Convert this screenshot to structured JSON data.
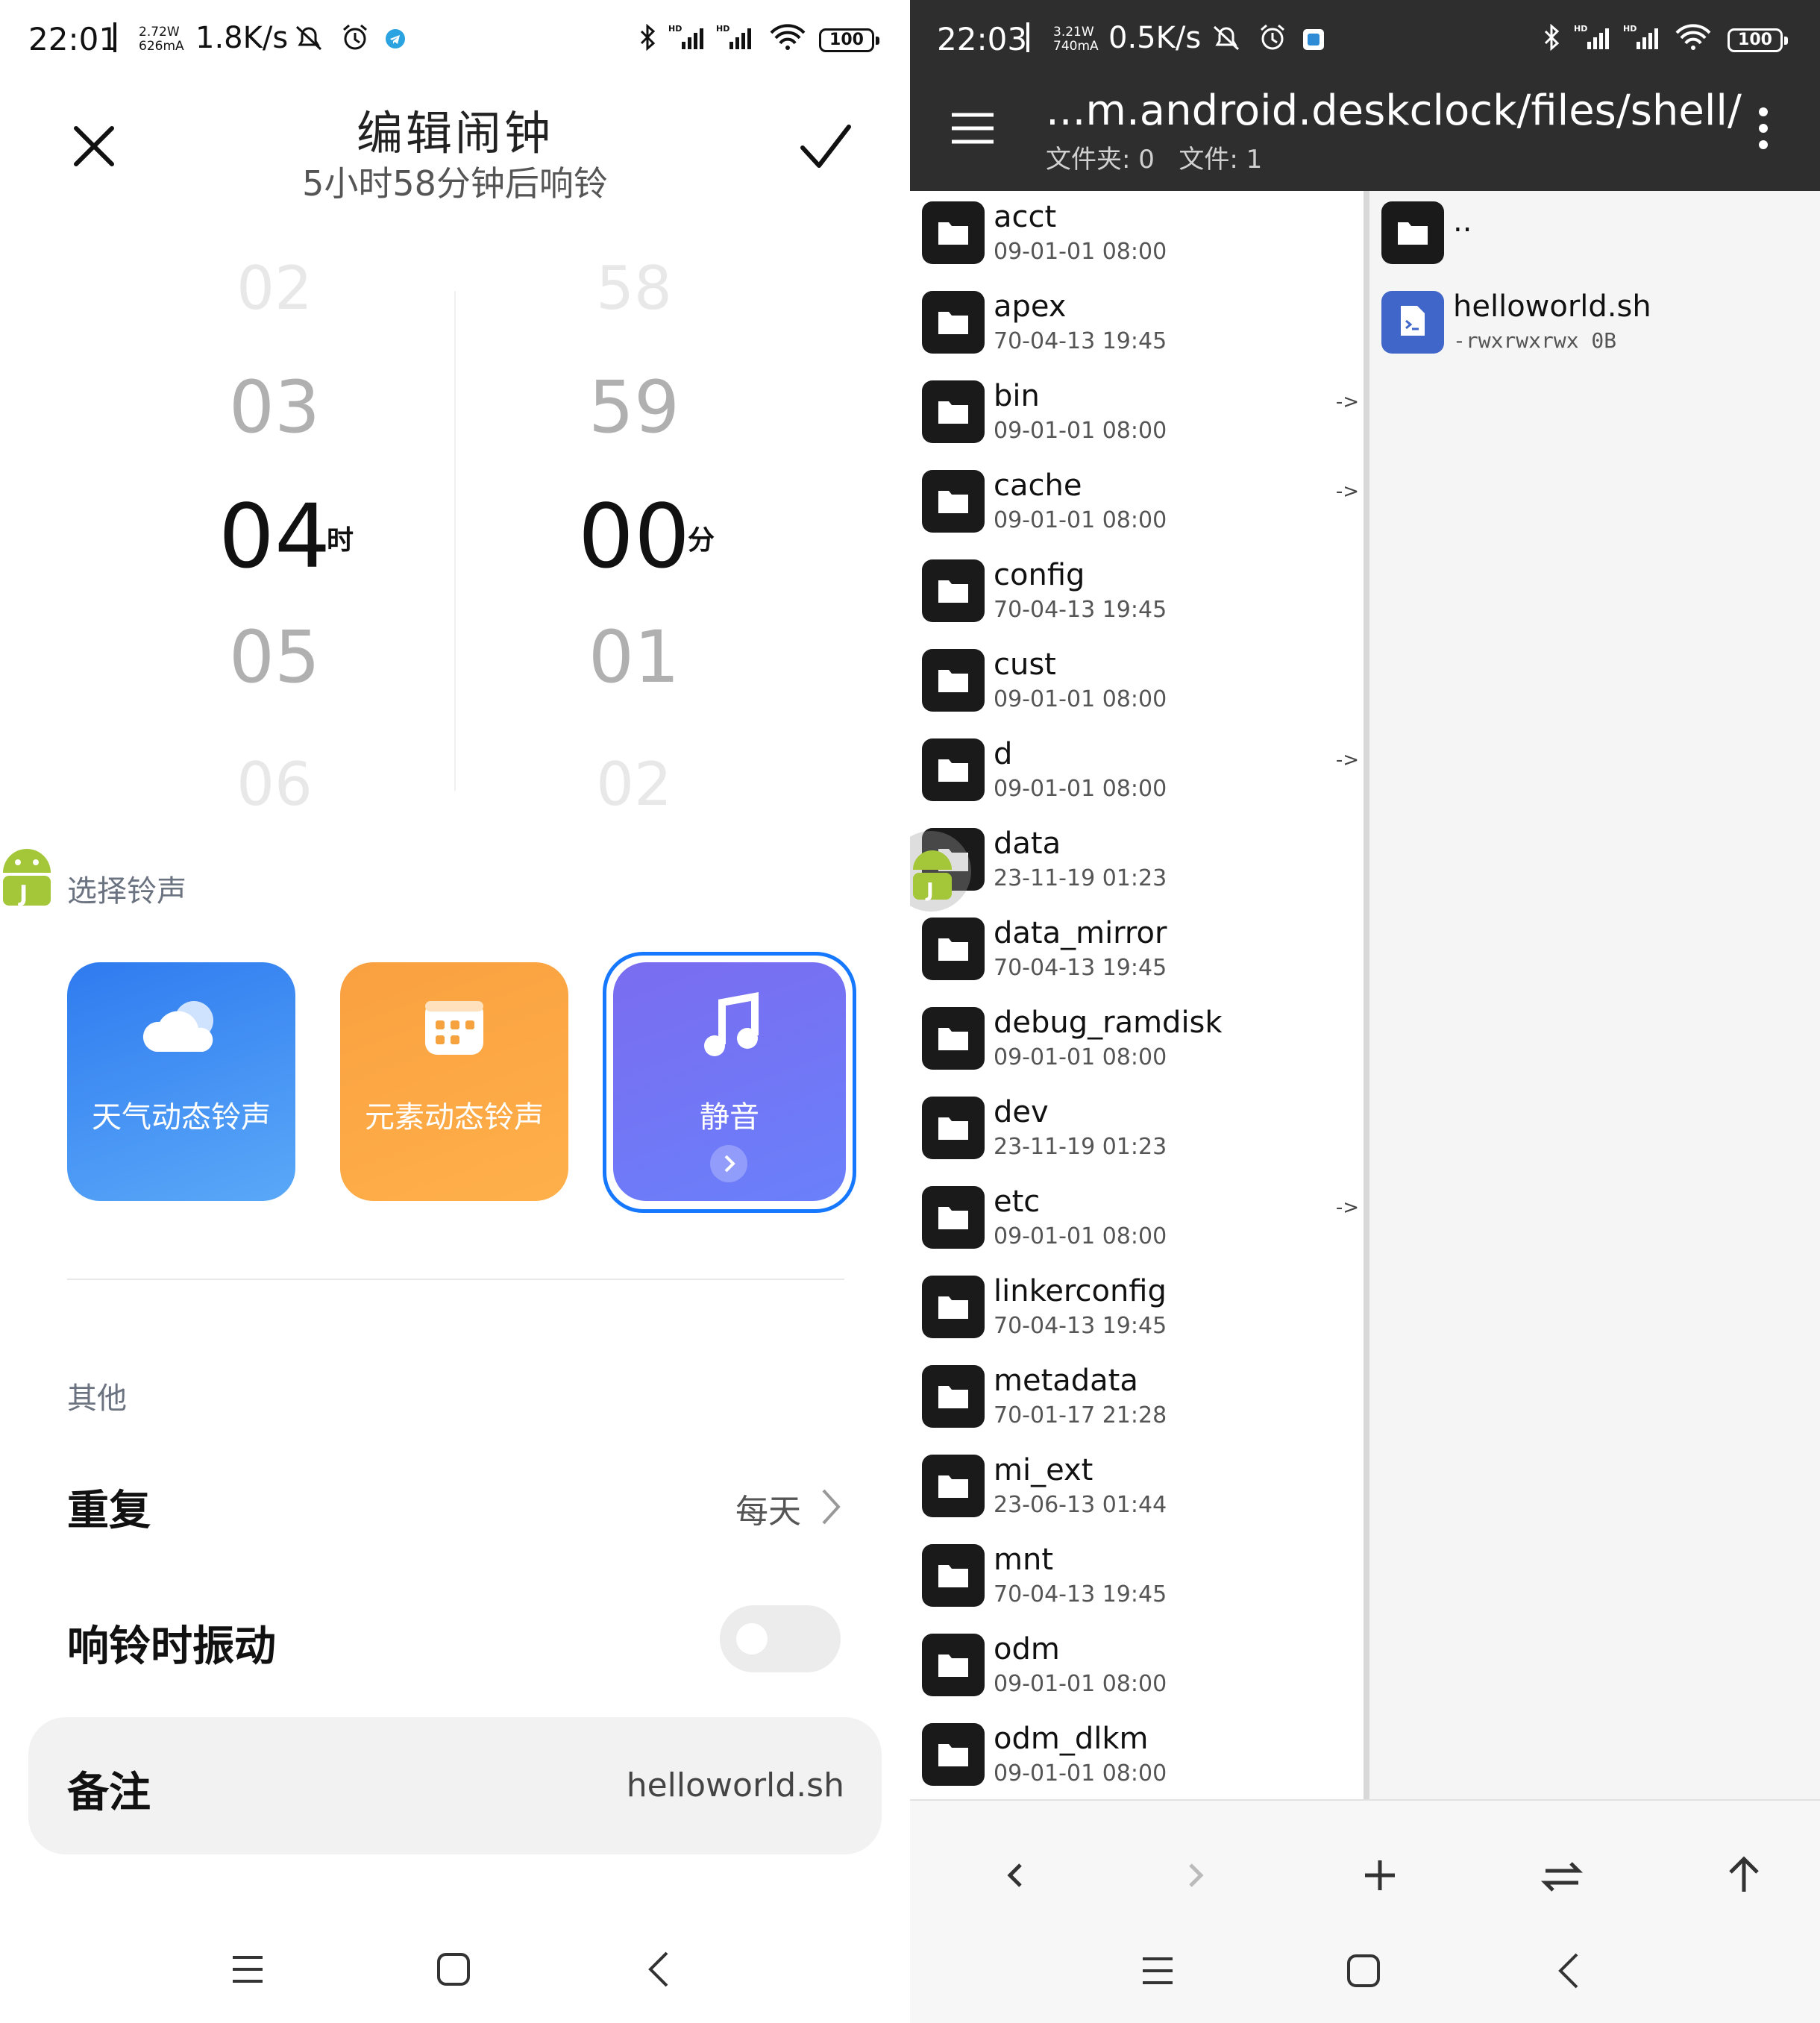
{
  "left": {
    "status_bar": {
      "time": "22:01",
      "power_top": "2.72W",
      "power_bottom": "626mA",
      "speed": "1.8K/s",
      "battery": "100"
    },
    "header": {
      "title": "编辑闹钟",
      "subtitle": "5小时58分钟后响铃",
      "close_icon": "close-icon",
      "confirm_icon": "check-icon"
    },
    "picker": {
      "hours": [
        "02",
        "03",
        "04",
        "05",
        "06"
      ],
      "minutes": [
        "58",
        "59",
        "00",
        "01",
        "02"
      ],
      "hour_unit": "时",
      "minute_unit": "分"
    },
    "ringtone": {
      "section_label": "选择铃声",
      "cards": [
        {
          "label": "天气动态铃声",
          "icon": "cloud-icon"
        },
        {
          "label": "元素动态铃声",
          "icon": "grid-icon"
        },
        {
          "label": "静音",
          "icon": "music-note-icon"
        }
      ]
    },
    "other": {
      "section_label": "其他",
      "repeat_label": "重复",
      "repeat_value": "每天",
      "vibrate_label": "响铃时振动",
      "vibrate_on": false,
      "note_label": "备注",
      "note_value": "helloworld.sh"
    }
  },
  "right": {
    "status_bar": {
      "time": "22:03",
      "power_top": "3.21W",
      "power_bottom": "740mA",
      "speed": "0.5K/s",
      "battery": "100"
    },
    "toolbar": {
      "path": "...m.android.deskclock/files/shell/",
      "folders_count": "文件夹: 0",
      "files_count": "文件: 1"
    },
    "left_list": [
      {
        "name": "acct",
        "date": "09-01-01 08:00",
        "link": ""
      },
      {
        "name": "apex",
        "date": "70-04-13 19:45",
        "link": ""
      },
      {
        "name": "bin",
        "date": "09-01-01 08:00",
        "link": "->"
      },
      {
        "name": "cache",
        "date": "09-01-01 08:00",
        "link": "->"
      },
      {
        "name": "config",
        "date": "70-04-13 19:45",
        "link": ""
      },
      {
        "name": "cust",
        "date": "09-01-01 08:00",
        "link": ""
      },
      {
        "name": "d",
        "date": "09-01-01 08:00",
        "link": "->"
      },
      {
        "name": "data",
        "date": "23-11-19 01:23",
        "link": ""
      },
      {
        "name": "data_mirror",
        "date": "70-04-13 19:45",
        "link": ""
      },
      {
        "name": "debug_ramdisk",
        "date": "09-01-01 08:00",
        "link": ""
      },
      {
        "name": "dev",
        "date": "23-11-19 01:23",
        "link": ""
      },
      {
        "name": "etc",
        "date": "09-01-01 08:00",
        "link": "->"
      },
      {
        "name": "linkerconfig",
        "date": "70-04-13 19:45",
        "link": ""
      },
      {
        "name": "metadata",
        "date": "70-01-17 21:28",
        "link": ""
      },
      {
        "name": "mi_ext",
        "date": "23-06-13 01:44",
        "link": ""
      },
      {
        "name": "mnt",
        "date": "70-04-13 19:45",
        "link": ""
      },
      {
        "name": "odm",
        "date": "09-01-01 08:00",
        "link": ""
      },
      {
        "name": "odm_dlkm",
        "date": "09-01-01 08:00",
        "link": ""
      }
    ],
    "right_list": {
      "parent": "..",
      "file_name": "helloworld.sh",
      "file_meta": "-rwxrwxrwx 0B"
    }
  }
}
